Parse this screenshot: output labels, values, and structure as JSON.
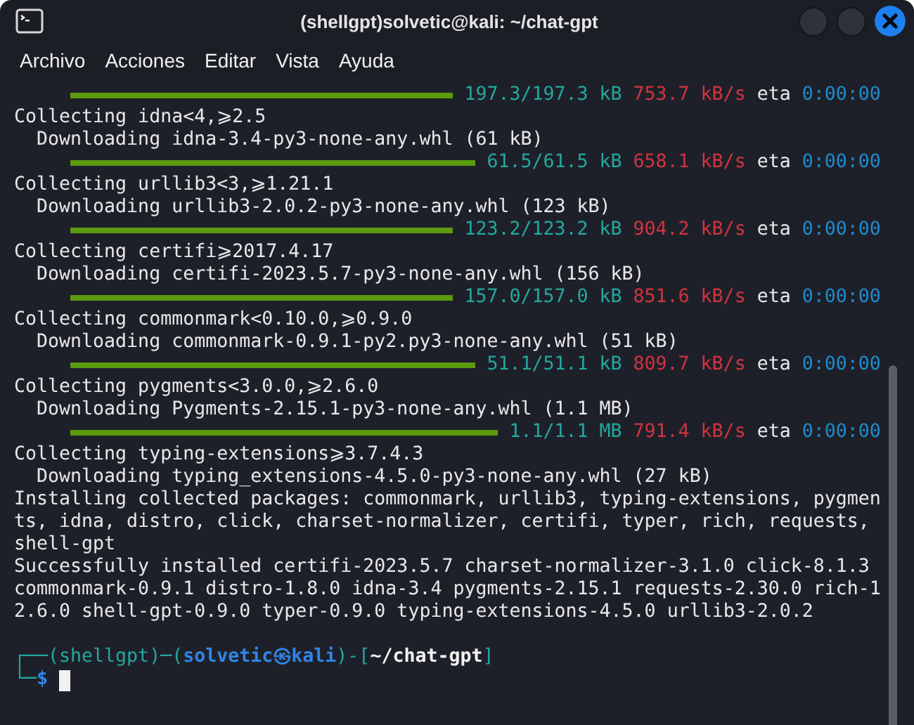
{
  "window": {
    "title": "(shellgpt)solvetic@kali: ~/chat-gpt"
  },
  "menu": [
    {
      "label": "Archivo"
    },
    {
      "label": "Acciones"
    },
    {
      "label": "Editar"
    },
    {
      "label": "Vista"
    },
    {
      "label": "Ayuda"
    }
  ],
  "terminal": {
    "lines": [
      {
        "kind": "progress",
        "size": "197.3/197.3 kB",
        "speed": "753.7 kB/s",
        "eta_label": "eta",
        "eta": "0:00:00"
      },
      {
        "kind": "text",
        "text": "Collecting idna<4,⩾2.5"
      },
      {
        "kind": "text",
        "text": "  Downloading idna-3.4-py3-none-any.whl (61 kB)"
      },
      {
        "kind": "progress",
        "size": "61.5/61.5 kB",
        "speed": "658.1 kB/s",
        "eta_label": "eta",
        "eta": "0:00:00"
      },
      {
        "kind": "text",
        "text": "Collecting urllib3<3,⩾1.21.1"
      },
      {
        "kind": "text",
        "text": "  Downloading urllib3-2.0.2-py3-none-any.whl (123 kB)"
      },
      {
        "kind": "progress",
        "size": "123.2/123.2 kB",
        "speed": "904.2 kB/s",
        "eta_label": "eta",
        "eta": "0:00:00"
      },
      {
        "kind": "text",
        "text": "Collecting certifi⩾2017.4.17"
      },
      {
        "kind": "text",
        "text": "  Downloading certifi-2023.5.7-py3-none-any.whl (156 kB)"
      },
      {
        "kind": "progress",
        "size": "157.0/157.0 kB",
        "speed": "851.6 kB/s",
        "eta_label": "eta",
        "eta": "0:00:00"
      },
      {
        "kind": "text",
        "text": "Collecting commonmark<0.10.0,⩾0.9.0"
      },
      {
        "kind": "text",
        "text": "  Downloading commonmark-0.9.1-py2.py3-none-any.whl (51 kB)"
      },
      {
        "kind": "progress",
        "size": "51.1/51.1 kB",
        "speed": "809.7 kB/s",
        "eta_label": "eta",
        "eta": "0:00:00"
      },
      {
        "kind": "text",
        "text": "Collecting pygments<3.0.0,⩾2.6.0"
      },
      {
        "kind": "text",
        "text": "  Downloading Pygments-2.15.1-py3-none-any.whl (1.1 MB)"
      },
      {
        "kind": "progress",
        "size": "1.1/1.1 MB",
        "speed": "791.4 kB/s",
        "eta_label": "eta",
        "eta": "0:00:00"
      },
      {
        "kind": "text",
        "text": "Collecting typing-extensions⩾3.7.4.3"
      },
      {
        "kind": "text",
        "text": "  Downloading typing_extensions-4.5.0-py3-none-any.whl (27 kB)"
      },
      {
        "kind": "text",
        "text": "Installing collected packages: commonmark, urllib3, typing-extensions, pygmen"
      },
      {
        "kind": "text",
        "text": "ts, idna, distro, click, charset-normalizer, certifi, typer, rich, requests,"
      },
      {
        "kind": "text",
        "text": "shell-gpt"
      },
      {
        "kind": "text",
        "text": "Successfully installed certifi-2023.5.7 charset-normalizer-3.1.0 click-8.1.3"
      },
      {
        "kind": "text",
        "text": "commonmark-0.9.1 distro-1.8.0 idna-3.4 pygments-2.15.1 requests-2.30.0 rich-1"
      },
      {
        "kind": "text",
        "text": "2.6.0 shell-gpt-0.9.0 typer-0.9.0 typing-extensions-4.5.0 urllib3-2.0.2"
      },
      {
        "kind": "blank"
      },
      {
        "kind": "prompt",
        "frame_open": "┌──(shellgpt)─(",
        "user": "solvetic㉿kali",
        "frame_mid": ")-[",
        "path": "~/chat-gpt",
        "frame_close": "]"
      },
      {
        "kind": "input",
        "frame": "└─",
        "symbol": "$",
        "cursor": true
      }
    ]
  }
}
